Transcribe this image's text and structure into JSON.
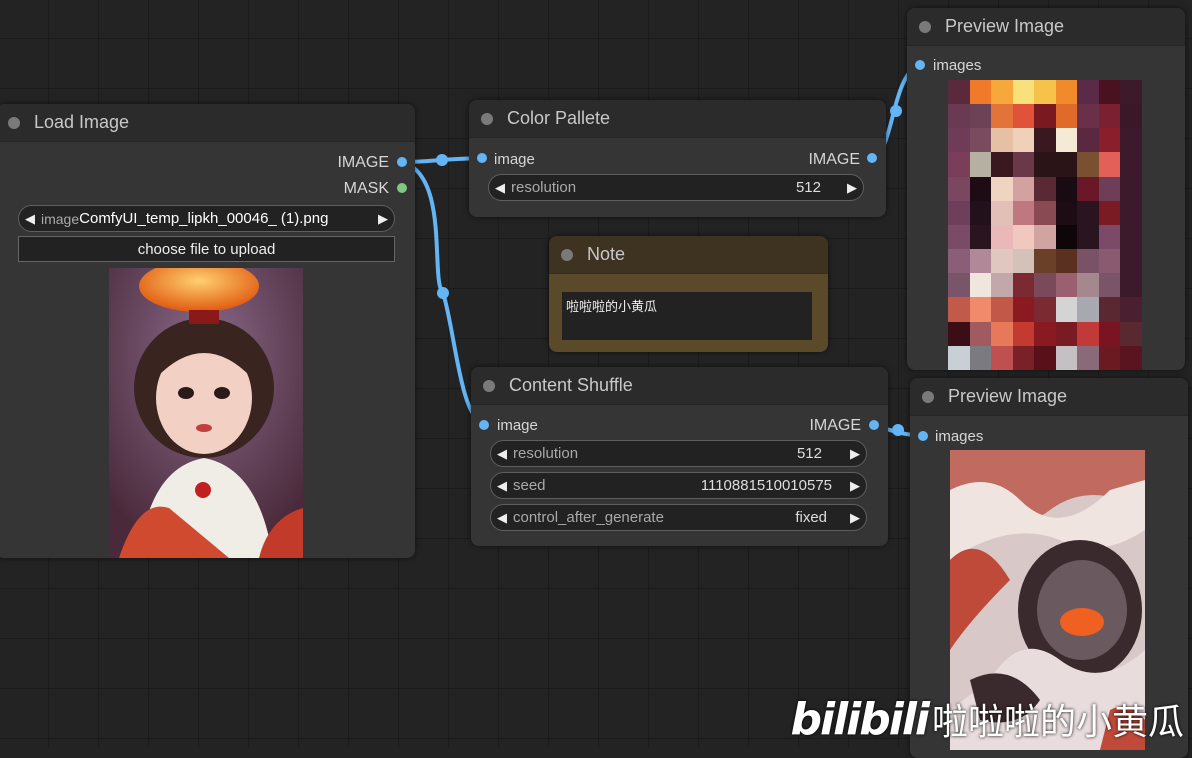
{
  "nodes": {
    "load_image": {
      "title": "Load Image",
      "outputs": [
        "IMAGE",
        "MASK"
      ],
      "widget_label": "image",
      "widget_value": "ComfyUI_temp_lipkh_00046_ (1).png",
      "upload_button": "choose file to upload"
    },
    "color_pallete": {
      "title": "Color Pallete",
      "input": "image",
      "output": "IMAGE",
      "resolution_label": "resolution",
      "resolution_value": "512"
    },
    "note": {
      "title": "Note",
      "text": "啦啦啦的小黄瓜"
    },
    "content_shuffle": {
      "title": "Content Shuffle",
      "input": "image",
      "output": "IMAGE",
      "resolution_label": "resolution",
      "resolution_value": "512",
      "seed_label": "seed",
      "seed_value": "1110881510010575",
      "control_label": "control_after_generate",
      "control_value": "fixed"
    },
    "preview_1": {
      "title": "Preview Image",
      "input": "images"
    },
    "preview_2": {
      "title": "Preview Image",
      "input": "images"
    }
  },
  "palette_colors": [
    "#5a2a3c",
    "#f07a2a",
    "#f6a83a",
    "#f8e07a",
    "#f6c24a",
    "#f08a2a",
    "#5a2a48",
    "#4a1220",
    "#3c1a2a",
    "#6a3a52",
    "#6e4256",
    "#e2743a",
    "#e0523a",
    "#7a1a20",
    "#e06a2a",
    "#6a3048",
    "#7a2030",
    "#3a1828",
    "#6e3c56",
    "#7a4a5e",
    "#e6c0a4",
    "#f0d0b8",
    "#3a1820",
    "#f4ead6",
    "#5a2840",
    "#8a1e2a",
    "#3c1a2c",
    "#7a3e5a",
    "#b6b0a2",
    "#3a1820",
    "#6a3848",
    "#2a1418",
    "#2a1418",
    "#7a5030",
    "#e26058",
    "#3c1a2c",
    "#7a4660",
    "#1e0c14",
    "#f0d4c2",
    "#d4a0a0",
    "#5a2a34",
    "#1a0a12",
    "#6a1828",
    "#6e3e58",
    "#3c1a2c",
    "#6e3e5a",
    "#22101a",
    "#e2c0b8",
    "#c07880",
    "#8a4a54",
    "#1e0c14",
    "#2a1420",
    "#7a1a22",
    "#3c1a2c",
    "#7a4a66",
    "#2a141e",
    "#eab8b8",
    "#f0c8c0",
    "#d0a4a0",
    "#0e0608",
    "#2a1420",
    "#7a4a68",
    "#3c1a2c",
    "#8a5e76",
    "#b08898",
    "#e0c8c0",
    "#d4c2b8",
    "#6a4028",
    "#5a3020",
    "#7a5268",
    "#8a5a70",
    "#3c1a2c",
    "#7a5468",
    "#f0e6de",
    "#c2a8a8",
    "#7a2a30",
    "#7a4a5a",
    "#9a6070",
    "#a4888e",
    "#7a5468",
    "#3c1a2c",
    "#c25a4a",
    "#f08a6a",
    "#c25848",
    "#8a1a20",
    "#7a2a30",
    "#d4d4d4",
    "#a8a8b0",
    "#5a2830",
    "#4a2030",
    "#3a0e14",
    "#a05a60",
    "#e8785a",
    "#c23a30",
    "#8a1a22",
    "#7a1a22",
    "#c23a38",
    "#7a1422",
    "#5a2830",
    "#c8d0d6",
    "#7a7a80",
    "#c05050",
    "#7a2028",
    "#5a1018",
    "#c4c0c4",
    "#8a6a78",
    "#6a1a20",
    "#5a1420"
  ]
}
